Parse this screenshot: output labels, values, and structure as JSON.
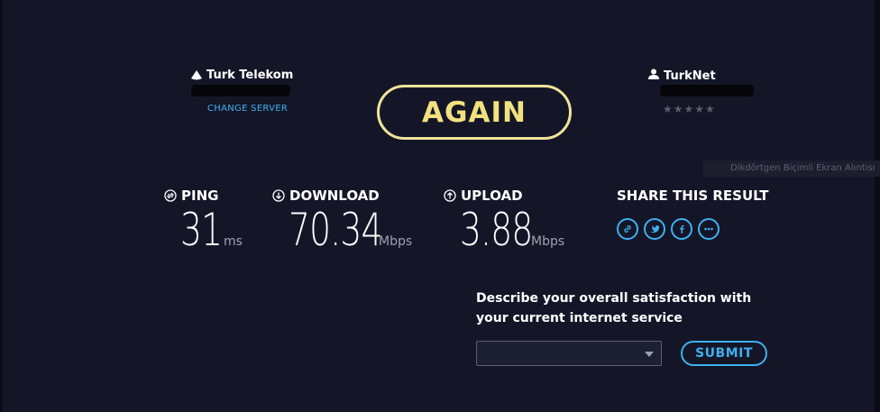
{
  "server": {
    "isp_name": "Turk Telekom",
    "change_server_label": "CHANGE SERVER",
    "host_name": "TurkNet",
    "rating_stars": "★★★★★"
  },
  "again_label": "AGAIN",
  "overlay_tooltip": "Dikdörtgen Biçimli Ekran Alıntısı",
  "metrics": {
    "ping": {
      "label": "PING",
      "value": "31",
      "unit": "ms"
    },
    "download": {
      "label": "DOWNLOAD",
      "value": "70.34",
      "unit": "Mbps"
    },
    "upload": {
      "label": "UPLOAD",
      "value": "3.88",
      "unit": "Mbps"
    }
  },
  "share": {
    "title": "SHARE THIS RESULT",
    "icons": [
      "link-icon",
      "twitter-icon",
      "facebook-icon",
      "more-icon"
    ]
  },
  "survey": {
    "question": "Describe your overall satisfaction with your current internet service",
    "selected_value": "",
    "submit_label": "SUBMIT"
  },
  "colors": {
    "background": "#141628",
    "accent_yellow": "#f2e27f",
    "accent_blue": "#3fb0f0"
  }
}
